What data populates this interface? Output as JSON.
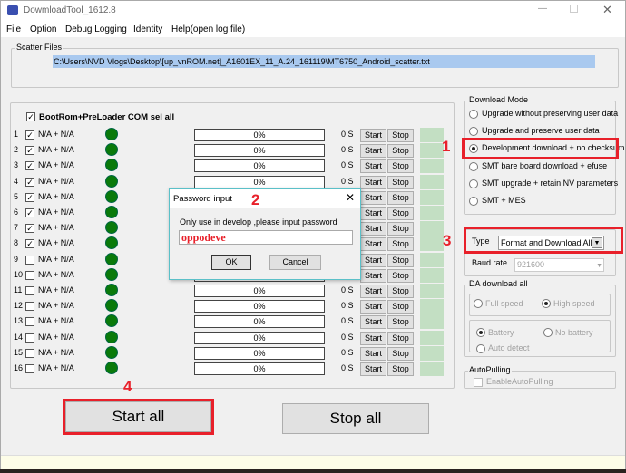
{
  "window": {
    "title": "DowmloadTool_1612.8"
  },
  "menu": [
    "File",
    "Option",
    "Debug Logging",
    "Identity",
    "Help(open log file)"
  ],
  "scatter": {
    "label": "Scatter Files",
    "path": "C:\\Users\\NVD Vlogs\\Desktop\\[up_vnROM.net]_A1601EX_11_A.24_161119\\MT6750_Android_scatter.txt"
  },
  "sel_all": {
    "label": "BootRom+PreLoader COM sel all",
    "checked": true
  },
  "ports": [
    {
      "n": "1",
      "name": "N/A + N/A",
      "checked": true,
      "progress": "0%",
      "time": "0 S"
    },
    {
      "n": "2",
      "name": "N/A + N/A",
      "checked": true,
      "progress": "0%",
      "time": "0 S"
    },
    {
      "n": "3",
      "name": "N/A + N/A",
      "checked": true,
      "progress": "0%",
      "time": "0 S"
    },
    {
      "n": "4",
      "name": "N/A + N/A",
      "checked": true,
      "progress": "0%",
      "time": "0 S"
    },
    {
      "n": "5",
      "name": "N/A + N/A",
      "checked": true,
      "progress": "0%",
      "time": "0 S"
    },
    {
      "n": "6",
      "name": "N/A + N/A",
      "checked": true,
      "progress": "0%",
      "time": "0 S"
    },
    {
      "n": "7",
      "name": "N/A + N/A",
      "checked": true,
      "progress": "0%",
      "time": "0 S"
    },
    {
      "n": "8",
      "name": "N/A + N/A",
      "checked": true,
      "progress": "0%",
      "time": "0 S"
    },
    {
      "n": "9",
      "name": "N/A + N/A",
      "checked": false,
      "progress": "0%",
      "time": "0 S"
    },
    {
      "n": "10",
      "name": "N/A + N/A",
      "checked": false,
      "progress": "0%",
      "time": "0 S"
    },
    {
      "n": "11",
      "name": "N/A + N/A",
      "checked": false,
      "progress": "0%",
      "time": "0 S"
    },
    {
      "n": "12",
      "name": "N/A + N/A",
      "checked": false,
      "progress": "0%",
      "time": "0 S"
    },
    {
      "n": "13",
      "name": "N/A + N/A",
      "checked": false,
      "progress": "0%",
      "time": "0 S"
    },
    {
      "n": "14",
      "name": "N/A + N/A",
      "checked": false,
      "progress": "0%",
      "time": "0 S"
    },
    {
      "n": "15",
      "name": "N/A + N/A",
      "checked": false,
      "progress": "0%",
      "time": "0 S"
    },
    {
      "n": "16",
      "name": "N/A + N/A",
      "checked": false,
      "progress": "0%",
      "time": "0 S"
    }
  ],
  "port_buttons": {
    "start": "Start",
    "stop": "Stop"
  },
  "download_mode": {
    "label": "Download Mode",
    "options": [
      "Upgrade without preserving user data",
      "Upgrade and preserve user data",
      "Development download + no checksum",
      "SMT bare board download + efuse",
      "SMT upgrade + retain NV parameters",
      "SMT + MES"
    ],
    "selected": 2
  },
  "type": {
    "label": "Type",
    "value": "Format and Download All"
  },
  "baud": {
    "label": "Baud rate",
    "value": "921600"
  },
  "da": {
    "label": "DA download all",
    "full": "Full speed",
    "high": "High speed",
    "battery": "Battery",
    "nobattery": "No battery",
    "auto": "Auto detect"
  },
  "autopulling": {
    "label": "AutoPulling",
    "checkbox": "EnableAutoPulling"
  },
  "start_all": "Start all",
  "stop_all": "Stop all",
  "dialog": {
    "title": "Password input",
    "prompt": "Only use in develop ,please input password",
    "value": "oppodeve",
    "ok": "OK",
    "cancel": "Cancel"
  },
  "annotations": [
    "1",
    "2",
    "3",
    "4"
  ],
  "colors": {
    "annotation": "#e8202a",
    "led": "#0a7a0a",
    "status_bar": "#fdfde8"
  }
}
